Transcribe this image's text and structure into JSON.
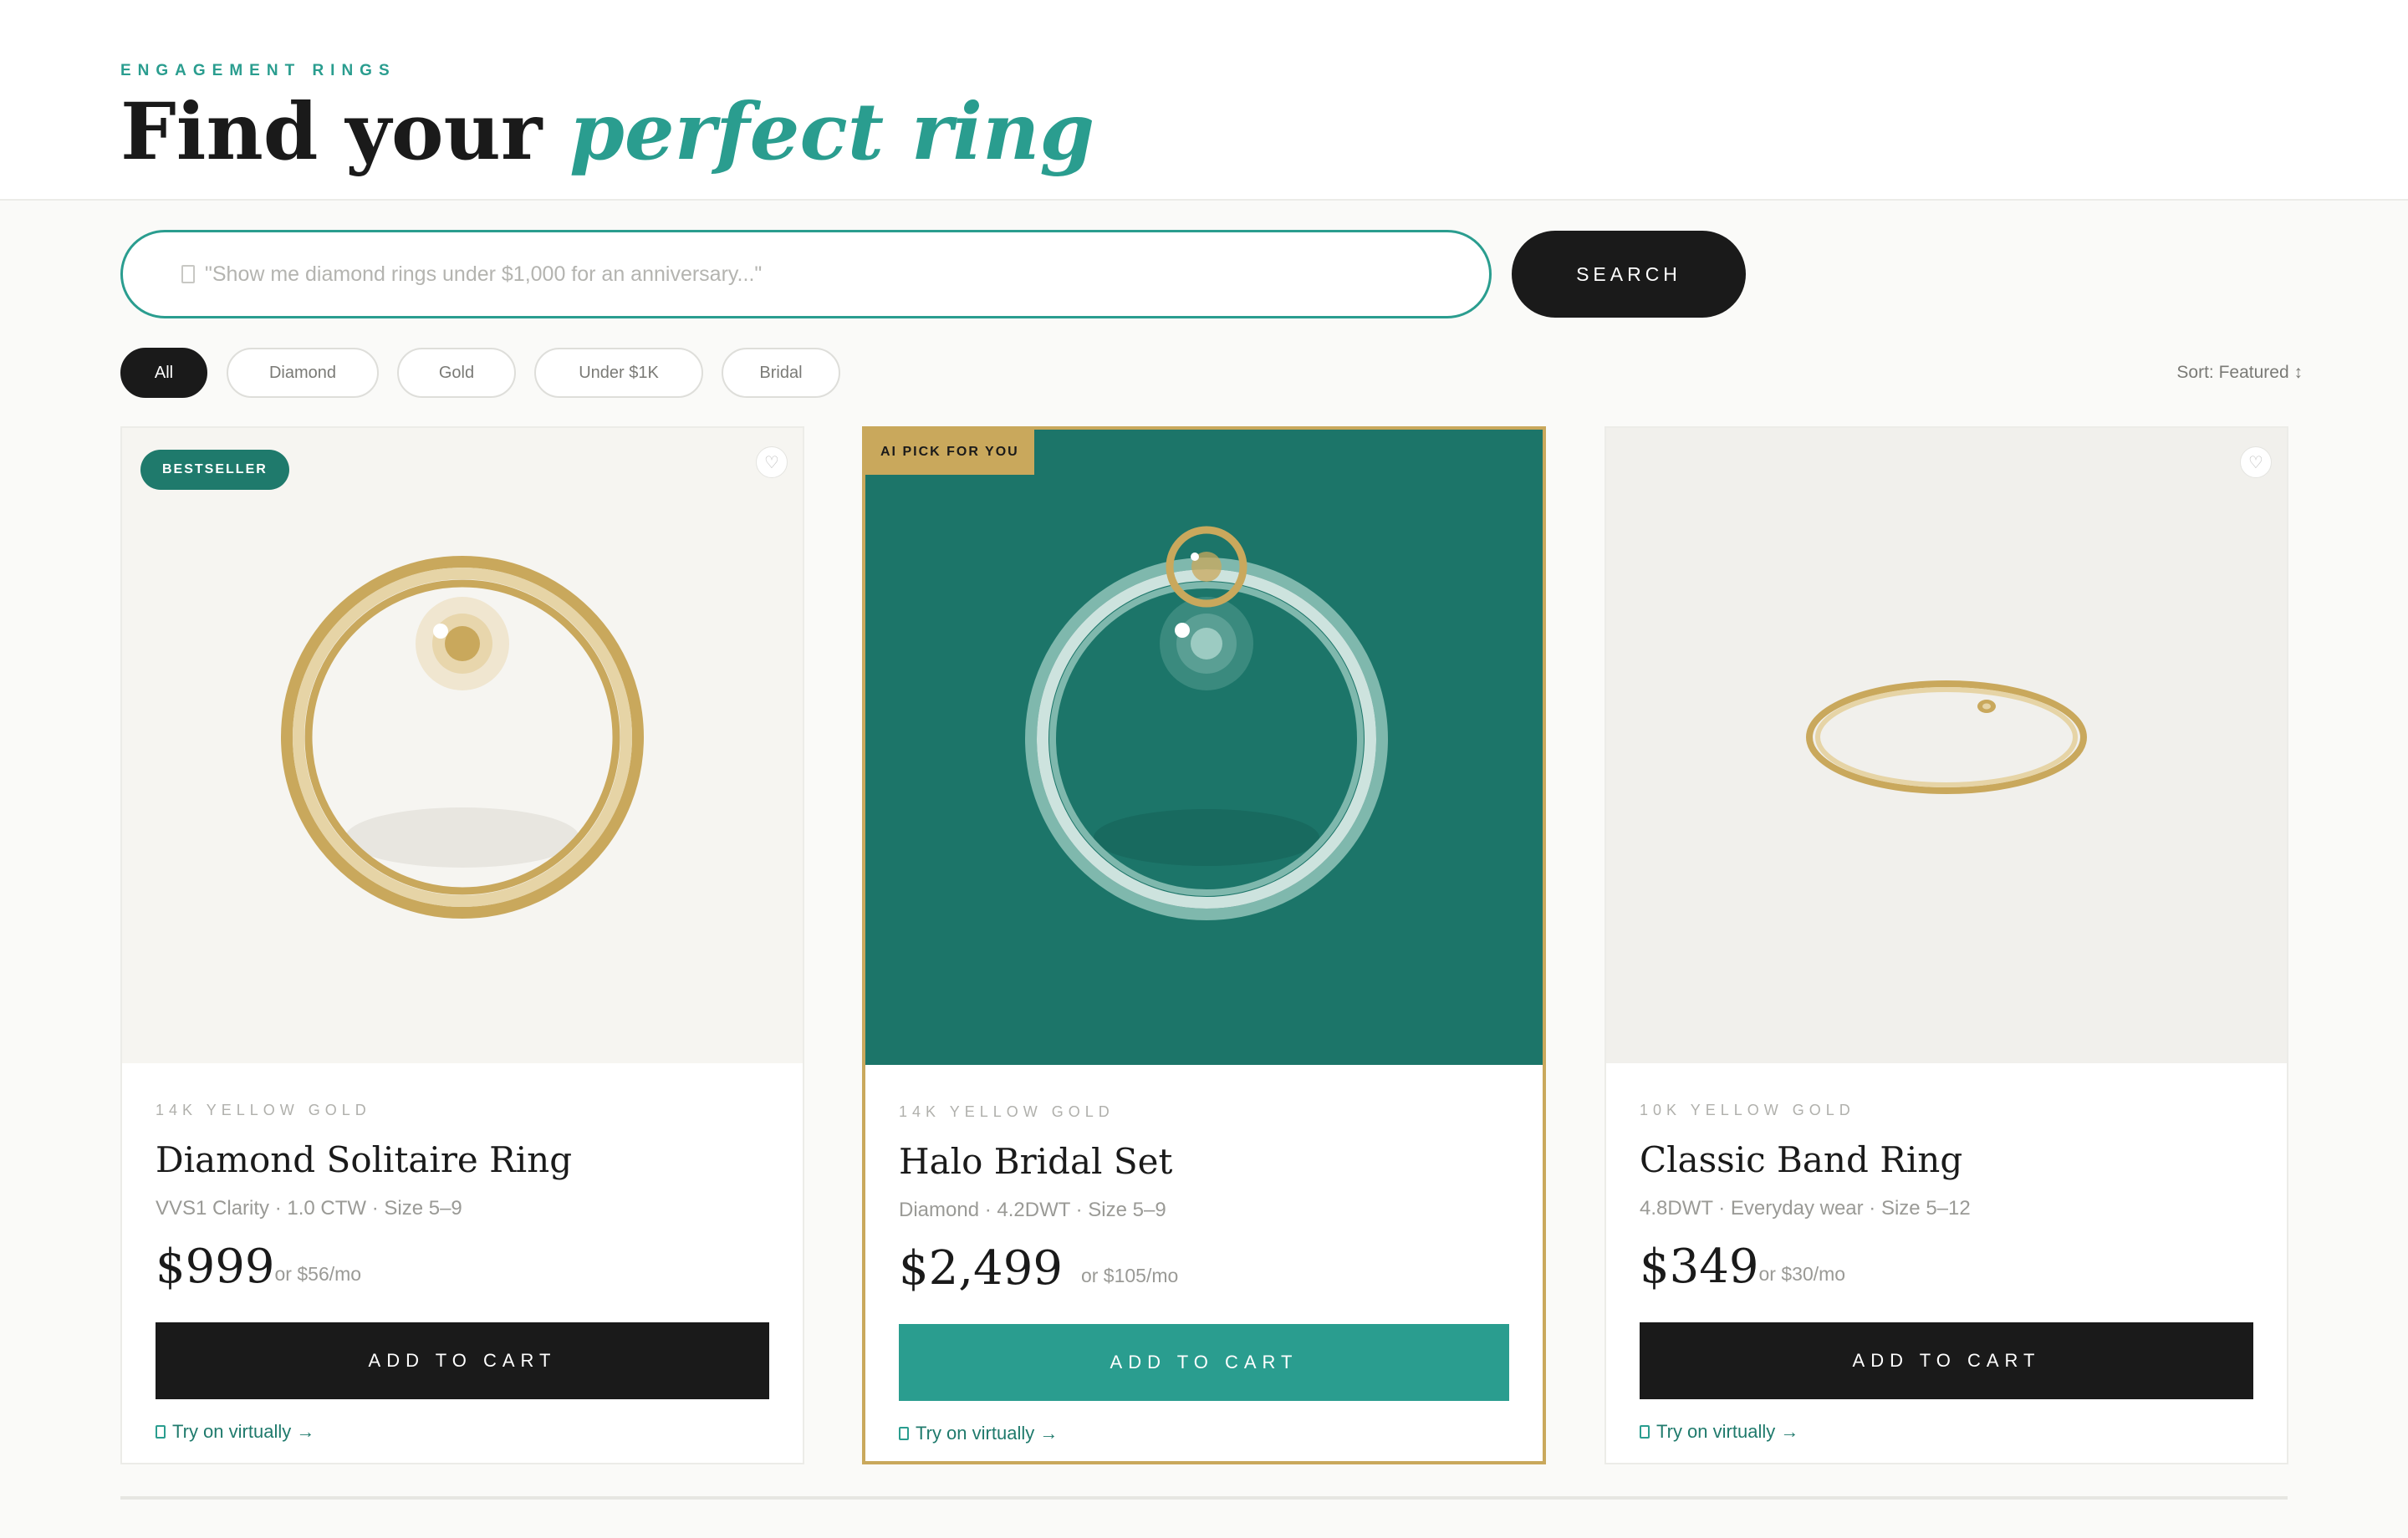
{
  "header": {
    "eyebrow": "ENGAGEMENT RINGS",
    "title_main": "Find your ",
    "title_accent": "perfect ring"
  },
  "search": {
    "placeholder": "\"Show me diamond rings under $1,000 for an anniversary...\"",
    "button_label": "SEARCH"
  },
  "filters": [
    {
      "label": "All",
      "active": true
    },
    {
      "label": "Diamond",
      "active": false
    },
    {
      "label": "Gold",
      "active": false
    },
    {
      "label": "Under $1K",
      "active": false
    },
    {
      "label": "Bridal",
      "active": false
    }
  ],
  "sort_label": "Sort: Featured ↕",
  "products": [
    {
      "badge": "BESTSELLER",
      "metal": "14K YELLOW GOLD",
      "name": "Diamond Solitaire Ring",
      "specs": "VVS1 Clarity · 1.0 CTW · Size 5–9",
      "price": "$999",
      "monthly": "or $56/mo",
      "cart_label": "ADD TO CART",
      "tryon_label": "Try on virtually →"
    },
    {
      "badge": "AI PICK FOR YOU",
      "metal": "14K YELLOW GOLD",
      "name": "Halo Bridal Set",
      "specs": "Diamond · 4.2DWT · Size 5–9",
      "price": "$2,499",
      "monthly": "or $105/mo",
      "cart_label": "ADD TO CART",
      "tryon_label": "Try on virtually →"
    },
    {
      "metal": "10K YELLOW GOLD",
      "name": "Classic Band Ring",
      "specs": "4.8DWT · Everyday wear · Size 5–12",
      "price": "$349",
      "monthly": "or $30/mo",
      "cart_label": "ADD TO CART",
      "tryon_label": "Try on virtually →"
    }
  ],
  "icons": {
    "heart": "heart-icon",
    "search": "search-icon",
    "tryon": "camera-icon"
  },
  "colors": {
    "accent": "#2a9d8f",
    "teal_dark": "#1f7a6c",
    "gold": "#c9a85c",
    "dark": "#1a1a1a"
  }
}
